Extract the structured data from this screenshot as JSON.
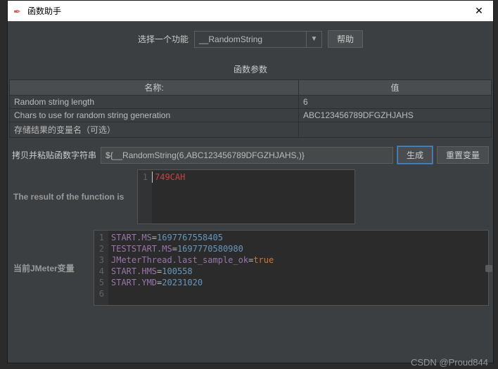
{
  "window": {
    "title": "函数助手",
    "close": "✕"
  },
  "selector": {
    "label": "选择一个功能",
    "value": "__RandomString",
    "help": "帮助"
  },
  "params": {
    "title": "函数参数",
    "col_name": "名称:",
    "col_value": "值",
    "rows": [
      {
        "name": "Random string length",
        "value": "6"
      },
      {
        "name": "Chars to use for random string generation",
        "value": "ABC123456789DFGZHJAHS"
      },
      {
        "name": "存储结果的变量名（可选）",
        "value": ""
      }
    ]
  },
  "gen": {
    "label": "拷贝并粘贴函数字符串",
    "expr": "${__RandomString(6,ABC123456789DFGZHJAHS,)}",
    "generate": "生成",
    "reset": "重置变量"
  },
  "result": {
    "label": "The result of the function is",
    "value": "749CAH"
  },
  "vars": {
    "label": "当前JMeter变量",
    "lines": [
      {
        "k": "START.MS",
        "v": "1697767558405",
        "t": "num"
      },
      {
        "k": "TESTSTART.MS",
        "v": "1697770580980",
        "t": "num"
      },
      {
        "k": "JMeterThread.last_sample_ok",
        "v": "true",
        "t": "bool"
      },
      {
        "k": "START.HMS",
        "v": "100558",
        "t": "num"
      },
      {
        "k": "START.YMD",
        "v": "20231020",
        "t": "num"
      }
    ]
  },
  "watermark": "CSDN @Proud844"
}
